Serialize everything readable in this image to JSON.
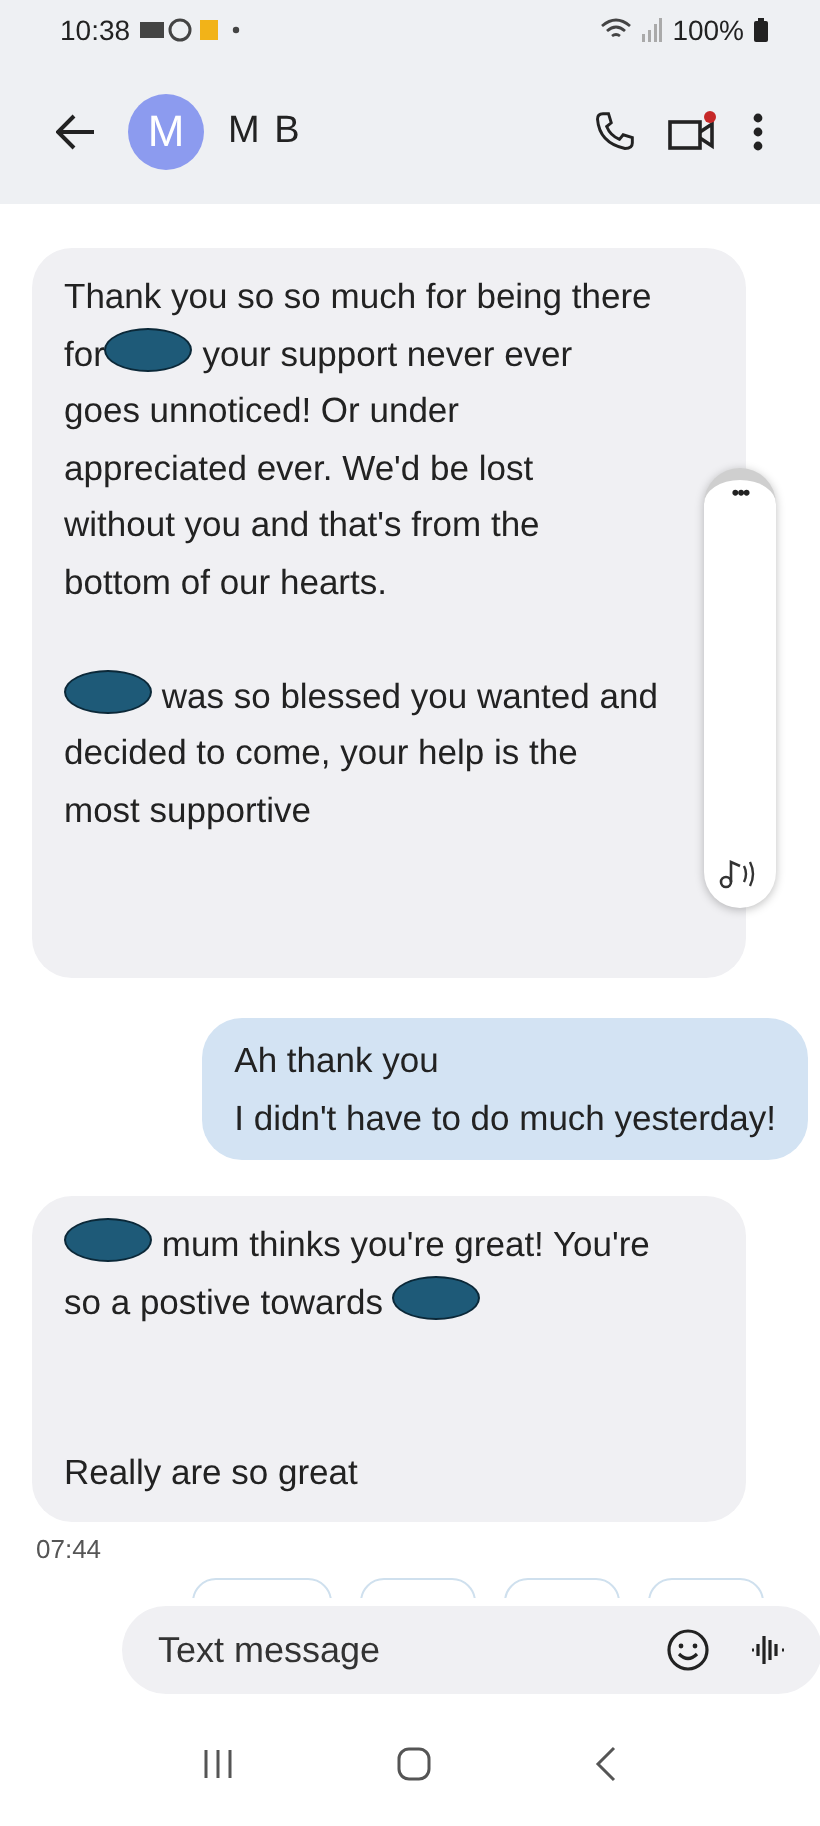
{
  "status_bar": {
    "time": "10:38",
    "battery": "100%"
  },
  "header": {
    "avatar_letter": "M",
    "contact_name": "M B",
    "video_notification": true
  },
  "messages": [
    {
      "outgoing": false,
      "lines": [
        {
          "kind": "text",
          "parts": [
            {
              "kind": "text",
              "text": "Thank you so so much for being there"
            }
          ]
        },
        {
          "kind": "text",
          "parts": [
            {
              "kind": "text",
              "text": "for"
            },
            {
              "kind": "redaction"
            },
            {
              "kind": "text",
              "text": " your support never ever"
            }
          ]
        },
        {
          "kind": "text",
          "parts": [
            {
              "kind": "text",
              "text": "goes unnoticed! Or under"
            }
          ]
        },
        {
          "kind": "text",
          "parts": [
            {
              "kind": "text",
              "text": "appreciated ever. We'd be lost"
            }
          ]
        },
        {
          "kind": "text",
          "parts": [
            {
              "kind": "text",
              "text": "without you and that's from the"
            }
          ]
        },
        {
          "kind": "text",
          "parts": [
            {
              "kind": "text",
              "text": "bottom of our hearts."
            }
          ]
        },
        {
          "kind": "blank"
        },
        {
          "kind": "text",
          "parts": [
            {
              "kind": "redaction"
            },
            {
              "kind": "text",
              "text": " was so blessed you wanted and"
            }
          ]
        },
        {
          "kind": "text",
          "parts": [
            {
              "kind": "text",
              "text": "decided to come, your help is the"
            }
          ]
        },
        {
          "kind": "text",
          "parts": [
            {
              "kind": "text",
              "text": "most supportive"
            }
          ]
        }
      ]
    },
    {
      "outgoing": true,
      "lines": [
        {
          "kind": "text",
          "parts": [
            {
              "kind": "text",
              "text": "Ah thank you"
            }
          ]
        },
        {
          "kind": "text",
          "parts": [
            {
              "kind": "text",
              "text": "I didn't have to do much yesterday!"
            }
          ]
        }
      ]
    },
    {
      "outgoing": false,
      "lines": [
        {
          "kind": "text",
          "parts": [
            {
              "kind": "redaction"
            },
            {
              "kind": "text",
              "text": " mum thinks you're great! You're"
            }
          ]
        },
        {
          "kind": "text",
          "parts": [
            {
              "kind": "text",
              "text": "so a postive towards "
            },
            {
              "kind": "redaction"
            }
          ]
        },
        {
          "kind": "blank"
        },
        {
          "kind": "blank"
        },
        {
          "kind": "text",
          "parts": [
            {
              "kind": "text",
              "text": "Really are so great"
            }
          ]
        }
      ],
      "timestamp": "07:44"
    }
  ],
  "side_panel": {
    "menu_glyph": "•••"
  },
  "composer": {
    "placeholder": "Text message"
  }
}
